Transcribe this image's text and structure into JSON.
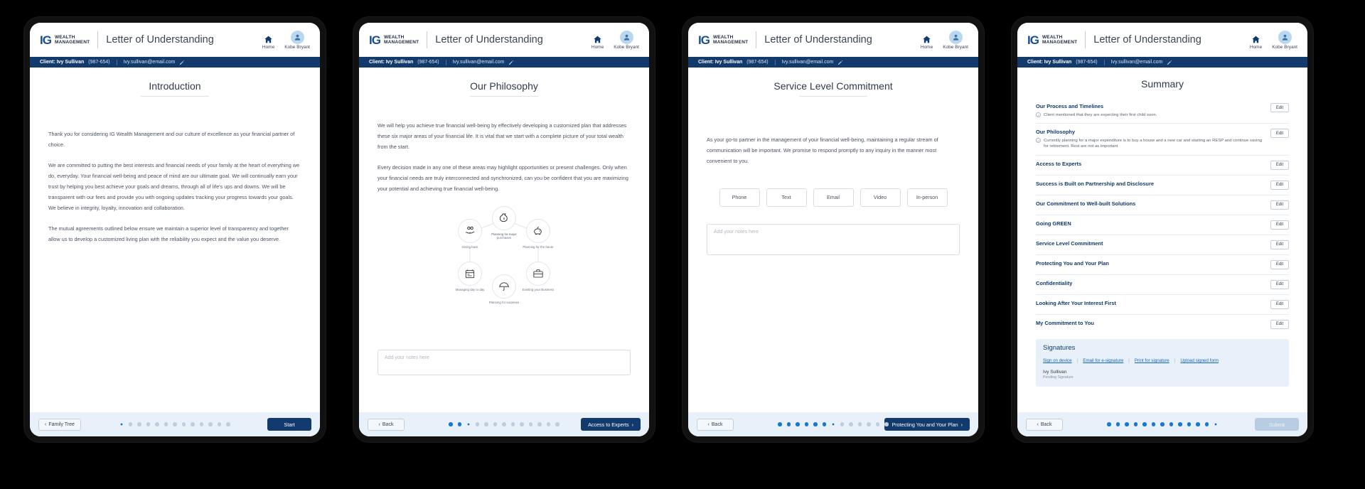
{
  "brand": {
    "logo_ig": "IG",
    "logo_line1": "WEALTH",
    "logo_line2": "MANAGEMENT",
    "app_title": "Letter of Understanding",
    "primary_color": "#123a6d",
    "accent_color": "#1878d4"
  },
  "header": {
    "home_label": "Home",
    "user_label": "Kobe Bryant"
  },
  "client_bar": {
    "name": "Client: Ivy Sullivan",
    "id": "(987-654)",
    "email": "Ivy.sullivan@email.com"
  },
  "panels": [
    {
      "page_title": "Introduction",
      "paragraphs": [
        "Thank you for considering IG Wealth Management and our culture of excellence as your financial partner of choice.",
        "We are committed to putting the best interests and financial needs of your family at the heart of everything we do, everyday. Your financial well-being and peace of mind are our ultimate goal. We will continually earn your trust by helping you best achieve your goals and dreams, through all of life's ups and downs. We will be transparent with our fees and provide you with ongoing updates tracking your progress towards your goals. We believe in integrity, loyalty, innovation and collaboration.",
        "The mutual agreements outlined below ensure we maintain a superior level of transparency and together allow us to develop a customized living plan with the reliability you expect and the value you deserve."
      ],
      "back_label": "Family Tree",
      "next_label": "Start",
      "dots_total": 13,
      "dots_active": 1
    },
    {
      "page_title": "Our Philosophy",
      "paragraphs": [
        "We will help you achieve true financial well-being by effectively developing a customized plan that addresses these six major areas of your financial life. It is vital that we start with a complete picture of your total wealth from the start.",
        "Every decision made in any one of these areas may highlight opportunities or present challenges. Only when your financial needs are truly interconnected and synchronized, can you be confident that you are maximizing your potential and achieving true financial well-being."
      ],
      "wheel": [
        {
          "label": "Planning for major purchases",
          "icon": "money-bag-icon"
        },
        {
          "label": "Giving back",
          "icon": "giving-hands-icon"
        },
        {
          "label": "Planning for the future",
          "icon": "piggy-bank-icon"
        },
        {
          "label": "Managing day to day",
          "icon": "calendar-icon"
        },
        {
          "label": "Planning for surprises",
          "icon": "umbrella-icon"
        },
        {
          "label": "Existing your Business",
          "icon": "briefcase-icon"
        }
      ],
      "notes_placeholder": "Add your notes here",
      "back_label": "Back",
      "next_label": "Access to Experts",
      "dots_total": 13,
      "dots_active": 3
    },
    {
      "page_title": "Service Level Commitment",
      "paragraphs": [
        "As your go-to partner in the management of your financial well-being, maintaining a regular stream of communication will be important. We promise to respond promptly to any inquiry in the manner most convenient to you."
      ],
      "chips": [
        "Phone",
        "Text",
        "Email",
        "Video",
        "In-person"
      ],
      "notes_placeholder": "Add your notes here",
      "back_label": "Back",
      "next_label": "Protecting You and Your Plan",
      "dots_total": 13,
      "dots_active": 7
    },
    {
      "page_title": "Summary",
      "edit_label": "Edit",
      "items": [
        {
          "title": "Our Process and Timelines",
          "note": "Client mentioned that they are expecting their first child soon."
        },
        {
          "title": "Our Philosophy",
          "note": "Currently planning for a major expenditure is to buy a house and a new car and starting an RESP and continue saving for retirement.  Rest are not as important"
        },
        {
          "title": "Access to Experts",
          "note": ""
        },
        {
          "title": "Success is Built on Partnership and Disclosure",
          "note": ""
        },
        {
          "title": "Our Commitment to Well-built Solutions",
          "note": ""
        },
        {
          "title": "Going GREEN",
          "note": ""
        },
        {
          "title": "Service Level Commitment",
          "note": ""
        },
        {
          "title": "Protecting You and Your Plan",
          "note": ""
        },
        {
          "title": "Confidentiality",
          "note": ""
        },
        {
          "title": "Looking After Your Interest First",
          "note": ""
        },
        {
          "title": "My Commitment to You",
          "note": ""
        }
      ],
      "signatures": {
        "title": "Signatures",
        "links": [
          "Sign on device",
          "Email for e-signature",
          "Print for signature",
          "Upload signed form"
        ],
        "signer_name": "Ivy Sullivan",
        "signer_sub": "Pending Signature"
      },
      "back_label": "Back",
      "next_label": "Submit",
      "dots_total": 13,
      "dots_active": 13
    }
  ]
}
